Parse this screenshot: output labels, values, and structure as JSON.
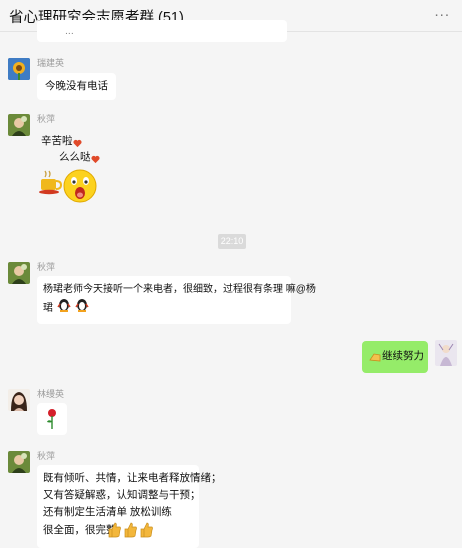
{
  "window": {
    "title": "省心理研究会志愿者群 (51)",
    "more_label": "..."
  },
  "messages": [
    {
      "sender": "",
      "text": "..."
    },
    {
      "sender": "瑞建英",
      "text": "今晚没有电话"
    },
    {
      "sender": "秋萍",
      "lines": [
        "辛苦啦",
        "么么哒"
      ]
    },
    {
      "timestamp": "22:10"
    },
    {
      "sender": "秋萍",
      "lines": [
        "杨珺老师今天接听一个来电者，很细致，过程很有条理 嘛@杨",
        "珺"
      ]
    },
    {
      "sender": "me",
      "text": "继续努力"
    },
    {
      "sender": "林缦英",
      "text": ""
    },
    {
      "sender": "秋萍",
      "lines": [
        "既有倾听、共情，让来电者释放情绪；",
        "又有答疑解惑，认知调整与干预；",
        "还有制定生活清单   放松训练",
        "很全面，很完整"
      ]
    }
  ],
  "colors": {
    "self_bubble": "#95ec69",
    "other_bubble": "#ffffff",
    "background": "#f5f5f5"
  }
}
